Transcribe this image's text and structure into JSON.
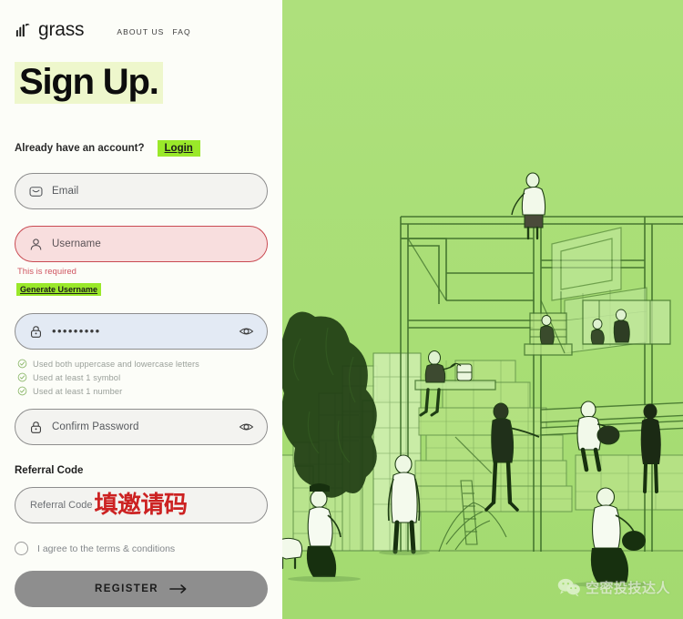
{
  "brand": {
    "name": "grass",
    "logo_icon": "grass-bars-icon"
  },
  "nav": {
    "items": [
      {
        "label": "ABOUT US",
        "name": "about-us"
      },
      {
        "label": "FAQ",
        "name": "faq"
      }
    ]
  },
  "heading": "Sign Up.",
  "account": {
    "prompt": "Already have an account?",
    "login_label": "Login"
  },
  "form": {
    "email": {
      "placeholder": "Email",
      "value": "",
      "icon": "envelope-icon"
    },
    "username": {
      "placeholder": "Username",
      "value": "",
      "icon": "user-icon",
      "error": "This is required",
      "generate_label": "Generate Username"
    },
    "password": {
      "placeholder": "",
      "value": "•••••••••",
      "icon": "lock-icon",
      "toggle_icon": "eye-icon",
      "rules": [
        {
          "text": "Used both uppercase and lowercase letters",
          "icon": "check-circle-icon",
          "met": true
        },
        {
          "text": "Used at least 1 symbol",
          "icon": "check-circle-icon",
          "met": true
        },
        {
          "text": "Used at least 1 number",
          "icon": "check-circle-icon",
          "met": true
        }
      ]
    },
    "confirm_password": {
      "placeholder": "Confirm Password",
      "value": "",
      "icon": "lock-icon",
      "toggle_icon": "eye-icon"
    },
    "referral": {
      "section_label": "Referral Code",
      "placeholder": "Referral Code",
      "value": "",
      "annotation": "填邀请码"
    },
    "terms": {
      "label": "I agree to the terms & conditions",
      "checked": false
    },
    "submit": {
      "label": "REGISTER",
      "icon": "arrow-right-icon",
      "disabled": true
    }
  },
  "illustration": {
    "alt": "green line-art city scene with people and scaffolding",
    "watermark_text": "空密投技达人",
    "watermark_icon": "wechat-icon"
  },
  "colors": {
    "accent_green": "#9ae82a",
    "highlight_green": "#eef7cc",
    "illustration_green": "#a8de75",
    "error_red": "#cf5560",
    "error_bg": "#f8dede",
    "autofill_blue": "#e3eaf4",
    "disabled_gray": "#8e8e8e",
    "annotation_red": "#cc2222"
  }
}
